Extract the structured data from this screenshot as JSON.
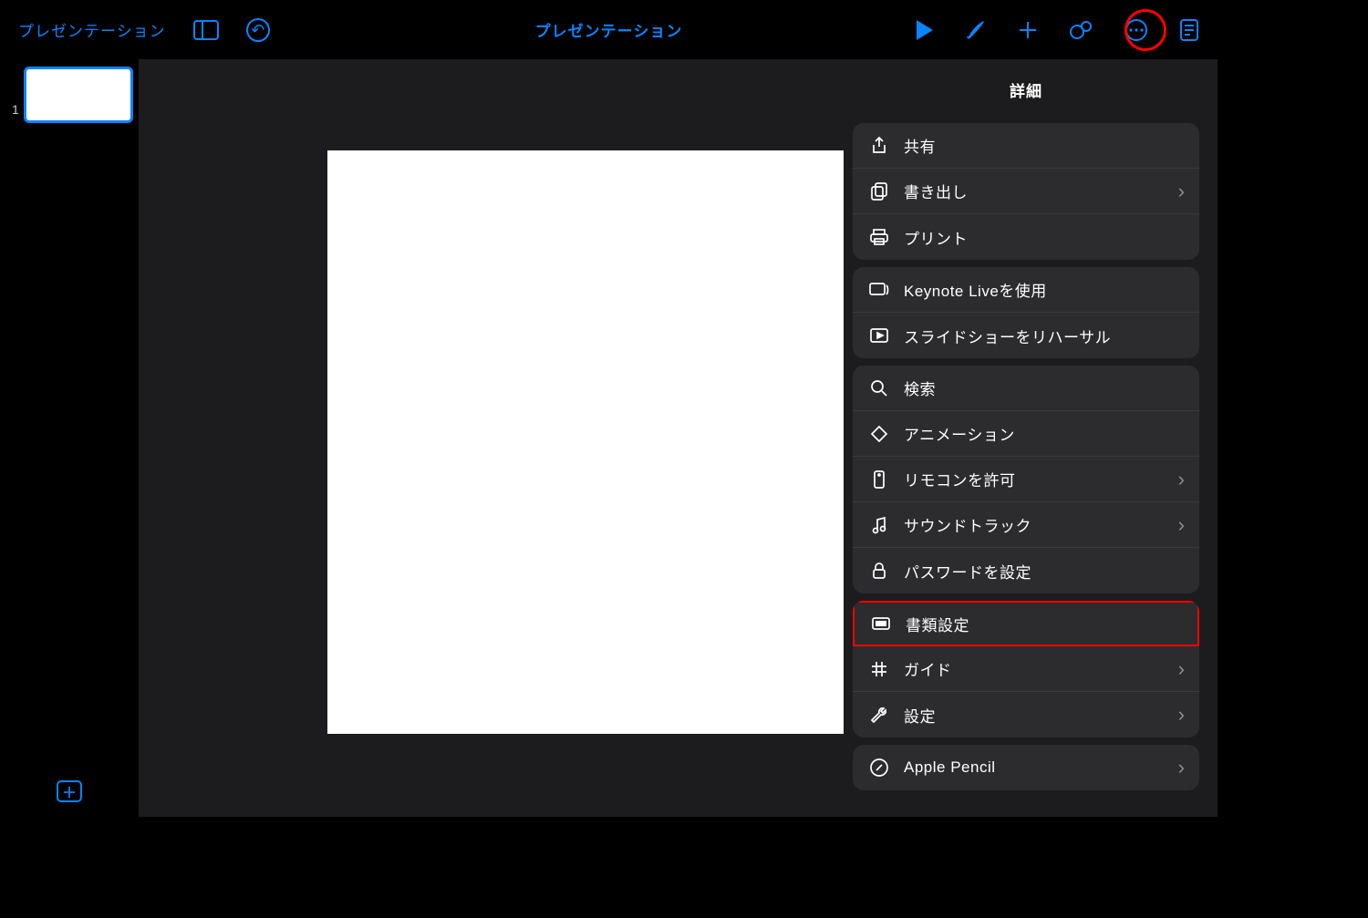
{
  "toolbar": {
    "back_label": "プレゼンテーション",
    "title": "プレゼンテーション"
  },
  "sidebar": {
    "slides": [
      {
        "number": "1"
      }
    ]
  },
  "popover": {
    "title": "詳細",
    "groups": [
      [
        {
          "id": "share",
          "label": "共有",
          "chevron": false
        },
        {
          "id": "export",
          "label": "書き出し",
          "chevron": true
        },
        {
          "id": "print",
          "label": "プリント",
          "chevron": false
        }
      ],
      [
        {
          "id": "keynote-live",
          "label": "Keynote Liveを使用",
          "chevron": false
        },
        {
          "id": "rehearse",
          "label": "スライドショーをリハーサル",
          "chevron": false
        }
      ],
      [
        {
          "id": "search",
          "label": "検索",
          "chevron": false
        },
        {
          "id": "animation",
          "label": "アニメーション",
          "chevron": false
        },
        {
          "id": "remote",
          "label": "リモコンを許可",
          "chevron": true
        },
        {
          "id": "soundtrack",
          "label": "サウンドトラック",
          "chevron": true
        },
        {
          "id": "password",
          "label": "パスワードを設定",
          "chevron": false
        }
      ],
      [
        {
          "id": "document-setup",
          "label": "書類設定",
          "chevron": false,
          "highlight": true
        },
        {
          "id": "guides",
          "label": "ガイド",
          "chevron": true
        },
        {
          "id": "settings",
          "label": "設定",
          "chevron": true
        }
      ],
      [
        {
          "id": "apple-pencil",
          "label": "Apple Pencil",
          "chevron": true
        }
      ]
    ]
  }
}
